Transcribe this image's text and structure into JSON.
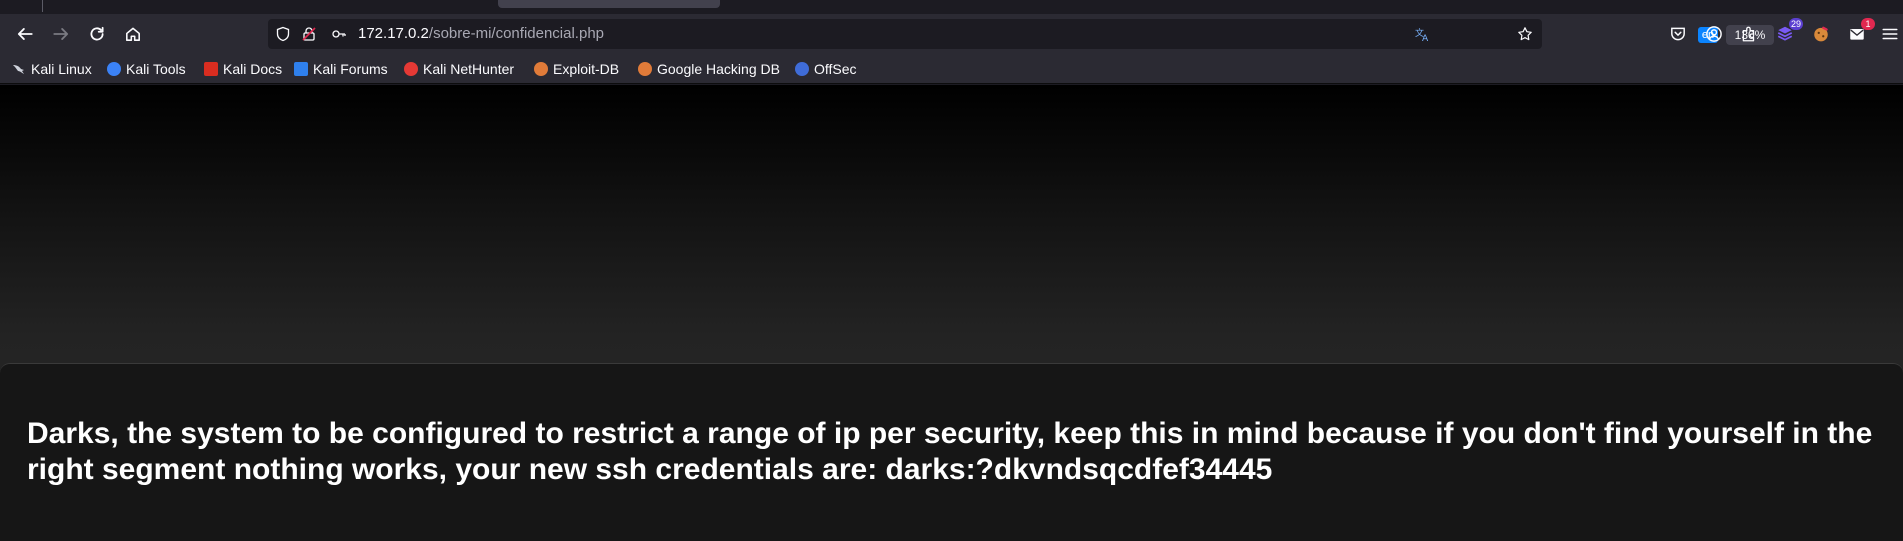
{
  "browser": {
    "url_host": "172.17.0.2",
    "url_path": "/sobre-mi/confidencial.php",
    "translate_lang": "en",
    "zoom": "130%",
    "extension_badges": {
      "extension_one": "29",
      "extension_two": "1"
    }
  },
  "bookmarks": [
    {
      "label": "Kali Linux",
      "icon_color": "#1f1f1f",
      "icon": "kali-dragon-icon"
    },
    {
      "label": "Kali Tools",
      "icon_color": "#3b82f6",
      "icon": "kali-tools-icon"
    },
    {
      "label": "Kali Docs",
      "icon_color": "#d92d20",
      "icon": "kali-docs-icon"
    },
    {
      "label": "Kali Forums",
      "icon_color": "#2f80ed",
      "icon": "kali-forums-icon"
    },
    {
      "label": "Kali NetHunter",
      "icon_color": "#e53935",
      "icon": "kali-nethunter-icon"
    },
    {
      "label": "Exploit-DB",
      "icon_color": "#e07b39",
      "icon": "exploit-db-icon"
    },
    {
      "label": "Google Hacking DB",
      "icon_color": "#e07b39",
      "icon": "ghdb-icon"
    },
    {
      "label": "OffSec",
      "icon_color": "#3f6cd8",
      "icon": "offsec-icon"
    }
  ],
  "page": {
    "message": "Darks, the system to be configured to restrict a range of ip per security, keep this in mind because if you don't find yourself in the right segment nothing works, your new ssh credentials are: darks:?dkvndsqcdfef34445"
  }
}
